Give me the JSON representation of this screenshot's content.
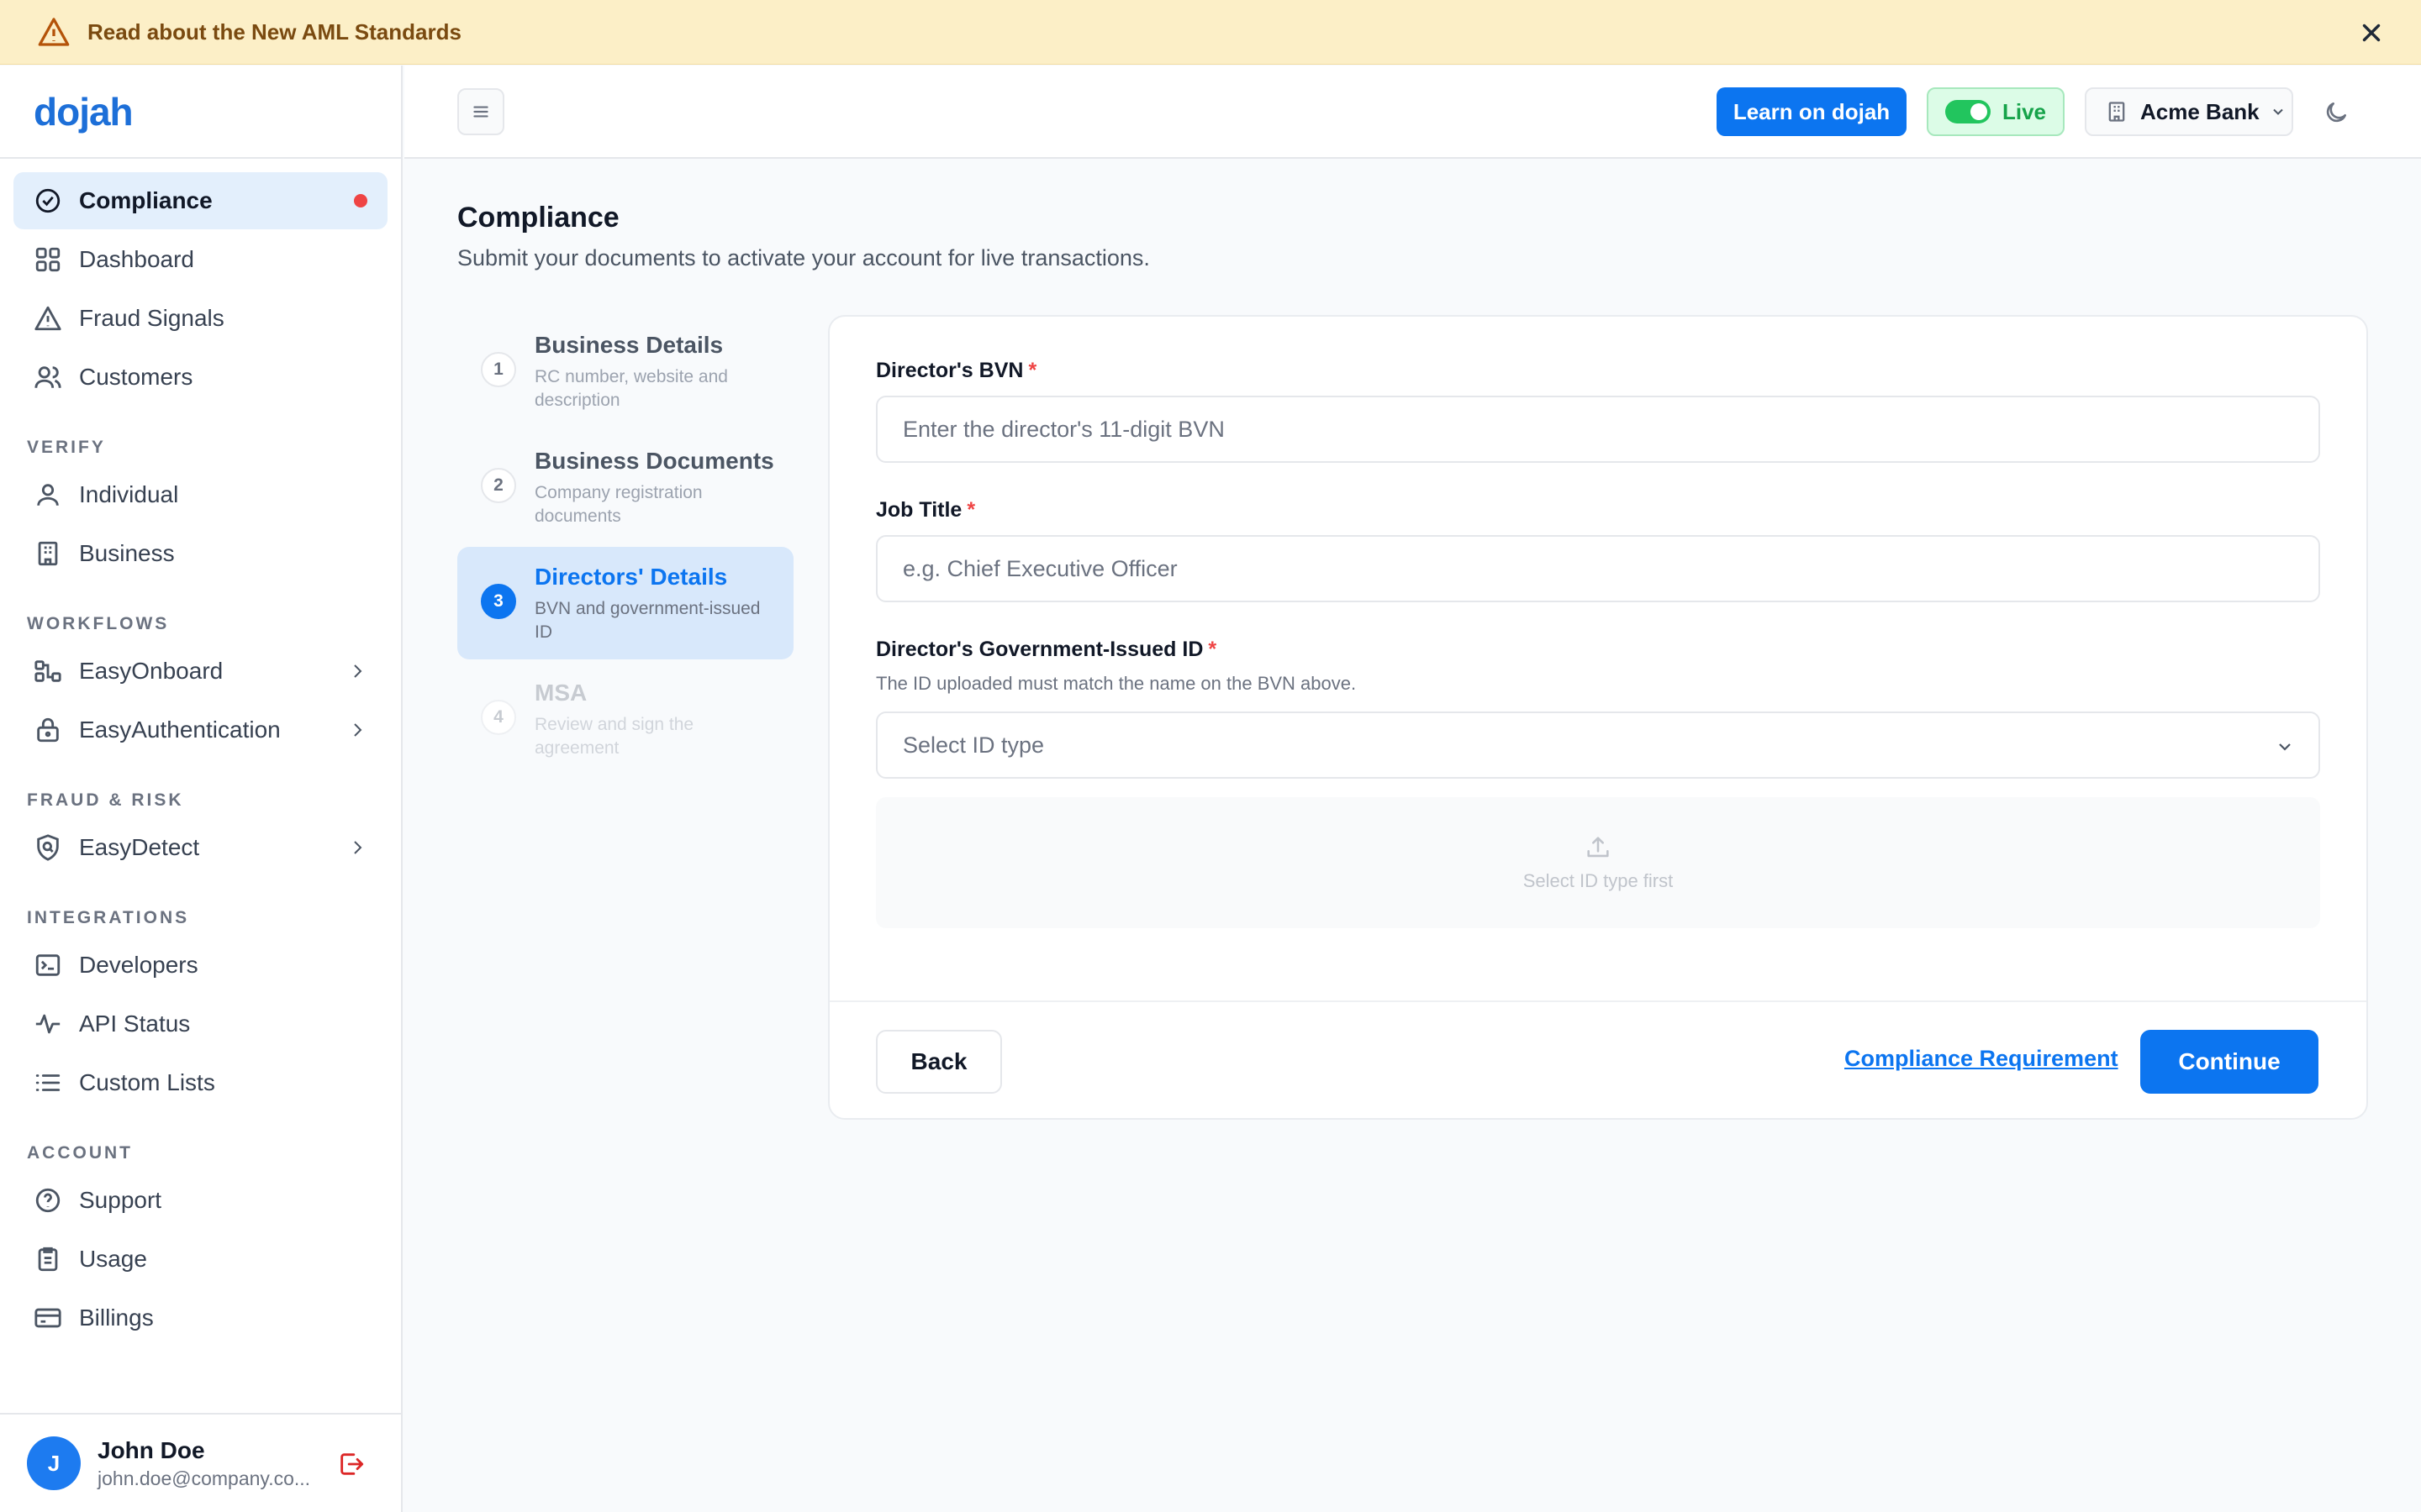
{
  "banner": {
    "text": "Read about the New AML Standards",
    "warn_icon": "warning-triangle-icon",
    "close_icon": "close-icon"
  },
  "brand": {
    "logo_text": "dojah",
    "accent": "#0c75f0"
  },
  "sidebar": {
    "top_items": [
      {
        "label": "Compliance",
        "icon": "check-circle-icon",
        "active": true,
        "has_dot": true
      },
      {
        "label": "Dashboard",
        "icon": "grid-icon"
      },
      {
        "label": "Fraud Signals",
        "icon": "warning-triangle-icon"
      },
      {
        "label": "Customers",
        "icon": "users-icon"
      }
    ],
    "sections": [
      {
        "title": "VERIFY",
        "items": [
          {
            "label": "Individual",
            "icon": "user-icon"
          },
          {
            "label": "Business",
            "icon": "building-icon"
          }
        ]
      },
      {
        "title": "WORKFLOWS",
        "items": [
          {
            "label": "EasyOnboard",
            "icon": "workflow-icon",
            "chevron": true
          },
          {
            "label": "EasyAuthentication",
            "icon": "lock-icon",
            "chevron": true
          }
        ]
      },
      {
        "title": "FRAUD & RISK",
        "items": [
          {
            "label": "EasyDetect",
            "icon": "shield-search-icon",
            "chevron": true
          }
        ]
      },
      {
        "title": "INTEGRATIONS",
        "items": [
          {
            "label": "Developers",
            "icon": "terminal-icon"
          },
          {
            "label": "API Status",
            "icon": "pulse-icon"
          },
          {
            "label": "Custom Lists",
            "icon": "list-icon"
          }
        ]
      },
      {
        "title": "ACCOUNT",
        "items": [
          {
            "label": "Support",
            "icon": "help-circle-icon"
          },
          {
            "label": "Usage",
            "icon": "clipboard-icon"
          },
          {
            "label": "Billings",
            "icon": "credit-card-icon"
          }
        ]
      }
    ],
    "user": {
      "initial": "J",
      "name": "John Doe",
      "email": "john.doe@company.co..."
    }
  },
  "topbar": {
    "learn_label": "Learn on dojah",
    "live_label": "Live",
    "org_name": "Acme Bank"
  },
  "page": {
    "title": "Compliance",
    "subtitle": "Submit your documents to activate your account for live transactions."
  },
  "steps": [
    {
      "num": "1",
      "title": "Business Details",
      "desc": "RC number, website and description",
      "state": "done"
    },
    {
      "num": "2",
      "title": "Business Documents",
      "desc": "Company registration documents",
      "state": "done"
    },
    {
      "num": "3",
      "title": "Directors' Details",
      "desc": "BVN and government-issued ID",
      "state": "active"
    },
    {
      "num": "4",
      "title": "MSA",
      "desc": "Review and sign the agreement",
      "state": "disabled"
    }
  ],
  "form": {
    "bvn_label": "Director's BVN",
    "bvn_placeholder": "Enter the director's 11-digit BVN",
    "job_label": "Job Title",
    "job_placeholder": "e.g. Chief Executive Officer",
    "id_label": "Director's Government-Issued ID",
    "id_help": "The ID uploaded must match the name on the BVN above.",
    "id_select": "Select ID type",
    "upload_text": "Select ID type first",
    "required_mark": "*"
  },
  "footer": {
    "back_label": "Back",
    "requirement_link": "Compliance Requirement",
    "continue_label": "Continue"
  }
}
